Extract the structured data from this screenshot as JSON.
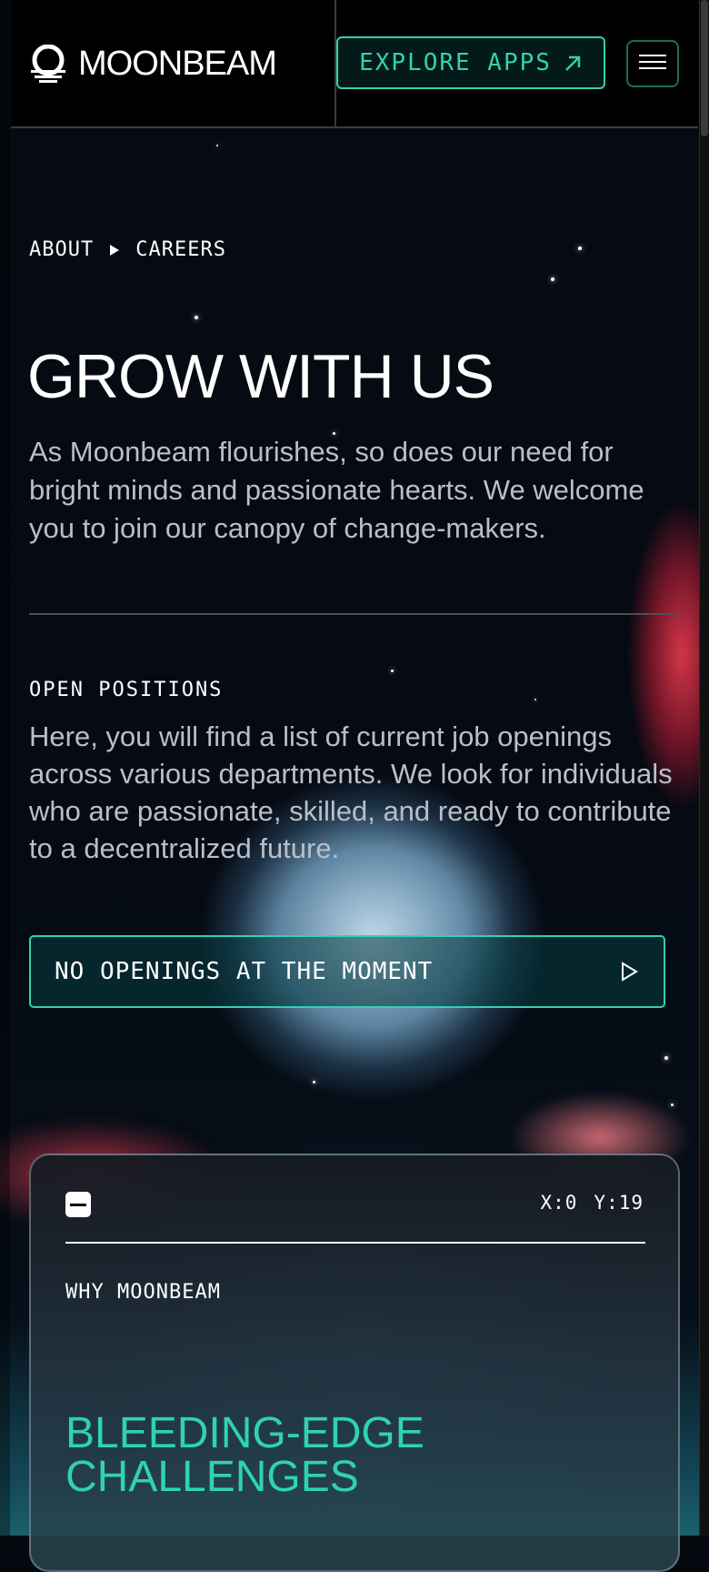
{
  "header": {
    "brand": "MOONBEAM",
    "explore_label": "EXPLORE APPS",
    "icons": {
      "logo": "moonbeam-logo-icon",
      "explore": "arrow-up-right-icon",
      "menu": "hamburger-menu-icon"
    }
  },
  "breadcrumb": {
    "items": [
      "ABOUT",
      "CAREERS"
    ]
  },
  "hero": {
    "title": "GROW WITH US",
    "description": "As Moonbeam flourishes, so does our need for bright minds and passionate hearts. We welcome you to join our canopy of change-makers."
  },
  "positions": {
    "label": "OPEN POSITIONS",
    "description": "Here, you will find a list of current job openings across various departments. We look for individuals who are passionate, skilled, and ready to contribute to a decentralized future.",
    "no_openings": "NO OPENINGS AT THE MOMENT"
  },
  "card": {
    "coord_x": "X:0",
    "coord_y": "Y:19",
    "label": "WHY MOONBEAM",
    "title_line1": "BLEEDING-EDGE",
    "title_line2": "CHALLENGES"
  },
  "colors": {
    "accent": "#2fd3b0",
    "background": "#05090f",
    "muted_text": "#b9bfc6"
  }
}
